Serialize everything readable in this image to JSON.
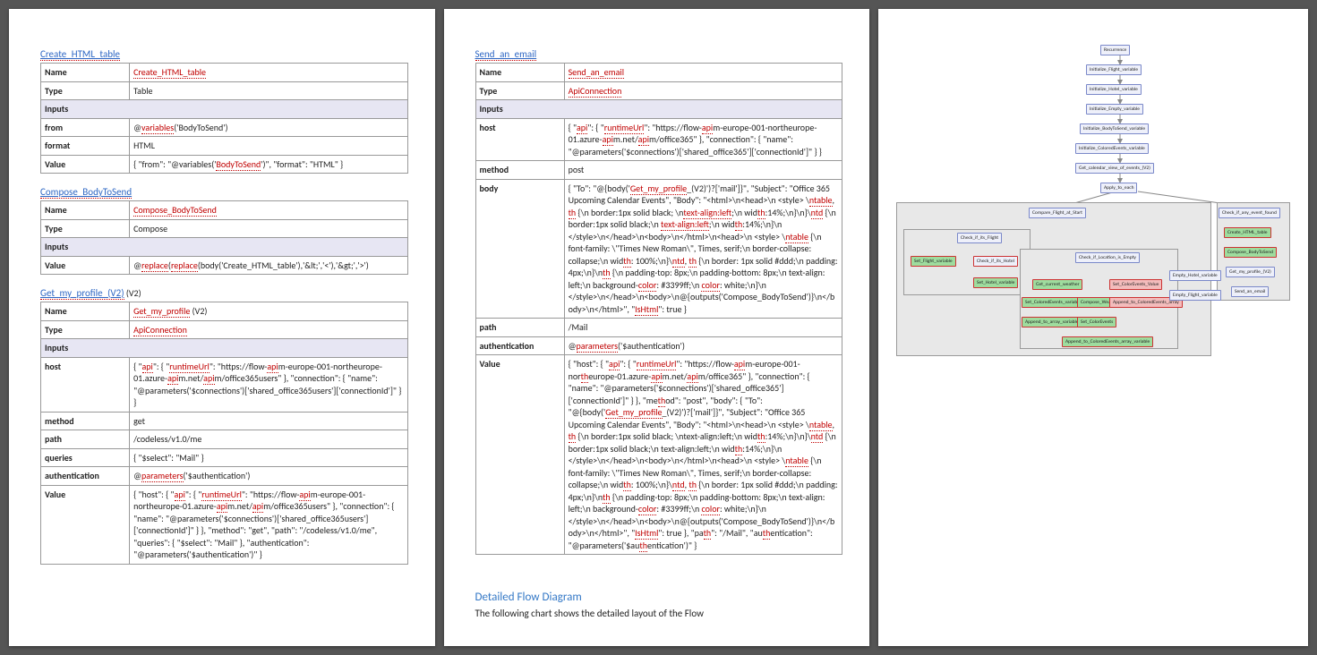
{
  "labels": {
    "name": "Name",
    "type": "Type",
    "inputs": "Inputs",
    "from": "from",
    "format": "format",
    "value": "Value",
    "host": "host",
    "method": "method",
    "path": "path",
    "queries": "queries",
    "auth": "authentication",
    "body": "body"
  },
  "tables": [
    {
      "anchor": "Create_HTML_table",
      "name": "Create_HTML_table",
      "name_sp": true,
      "type": "Table",
      "rows": [
        {
          "k": "from",
          "v": "@variables('BodyToSend')",
          "sp": [
            "variables"
          ]
        },
        {
          "k": "format",
          "v": "HTML"
        },
        {
          "k": "Value",
          "v": "{  \"from\": \"@variables('BodyToSend')\",  \"format\": \"HTML\" }",
          "sp": [
            "BodyToSend"
          ]
        }
      ]
    },
    {
      "anchor": "Compose_BodyToSend",
      "name": "Compose_BodyToSend",
      "name_sp": true,
      "type": "Compose",
      "rows": [
        {
          "k": "Value",
          "v": "@replace(replace(body('Create_HTML_table'),'&lt;','<'),'&gt;','>')",
          "sp": [
            "replace"
          ]
        }
      ]
    },
    {
      "anchor": "Get_my_profile_(V2)",
      "trail": " (V2)",
      "name": "Get_my_profile",
      "name_sp": true,
      "type": "ApiConnection",
      "type_sp": true,
      "rows": [
        {
          "k": "host",
          "v": "{  \"api\": {   \"runtimeUrl\": \"https://flow-apim-europe-001-northeurope-01.azure-apim.net/apim/office365users\"  },  \"connection\": {   \"name\": \"@parameters('$connections')['shared_office365users']['connectionId']\"  } }",
          "sp": [
            "api",
            "runtimeUrl"
          ]
        },
        {
          "k": "method",
          "v": "get"
        },
        {
          "k": "path",
          "v": "/codeless/v1.0/me"
        },
        {
          "k": "queries",
          "v": "{  \"$select\": \"Mail\" }"
        },
        {
          "k": "authentication",
          "v": "@parameters('$authentication')",
          "sp": [
            "parameters"
          ]
        },
        {
          "k": "Value",
          "v": "{  \"host\": {   \"api\": {    \"runtimeUrl\": \"https://flow-apim-europe-001-northeurope-01.azure-apim.net/apim/office365users\"   },   \"connection\": {    \"name\": \"@parameters('$connections')['shared_office365users']['connectionId']\"   }  },  \"method\": \"get\",  \"path\": \"/codeless/v1.0/me\",  \"queries\": {   \"$select\": \"Mail\"  },  \"authentication\": \"@parameters('$authentication')\" }",
          "sp": [
            "api",
            "runtimeUrl"
          ]
        }
      ]
    },
    {
      "anchor": "Send_an_email",
      "name": "Send_an_email",
      "name_sp": true,
      "type": "ApiConnection",
      "type_sp": true,
      "rows": [
        {
          "k": "host",
          "v": "{  \"api\": {   \"runtimeUrl\": \"https://flow-apim-europe-001-northeurope-01.azure-apim.net/apim/office365\"  },  \"connection\": {   \"name\": \"@parameters('$connections')['shared_office365']['connectionId']\"  } }",
          "sp": [
            "api",
            "runtimeUrl"
          ]
        },
        {
          "k": "method",
          "v": "post"
        },
        {
          "k": "body",
          "v": "{  \"To\": \"@{body('Get_my_profile_(V2)')?['mail']}\",  \"Subject\": \"Office 365 Upcoming Calendar Events\",  \"Body\": \"<html>\\n<head>\\n  <style> \\ntable, th {\\n    border:1px solid black;   \\ntext-align:left;\\n    width:14%;\\n}\\n}\\ntd {\\n    border:1px solid black;\\n    text-align:left;\\n    width:14%;\\n}\\n  </style>\\n</head>\\n<body>\\n</html>\\n<head>\\n  <style> \\ntable {\\n    font-family: \\\"Times New Roman\\\", Times, serif;\\n    border-collapse: collapse;\\n    width: 100%;\\n}\\ntd, th {\\n    border: 1px solid #ddd;\\n    padding: 4px;\\n}\\nth {\\n    padding-top: 8px;\\n    padding-bottom: 8px;\\n    text-align: left;\\n    background-color: #3399ff;\\n    color: white;\\n}\\n  </style>\\n</head>\\n<body>\\n@{outputs('Compose_BodyToSend')}\\n</body>\\n</html>\",  \"IsHtml\": true }",
          "sp": [
            "Get_my_profile",
            "ntable",
            "th",
            "ntd",
            "text-align:left",
            "color",
            "IsHtml"
          ]
        },
        {
          "k": "path",
          "v": "/Mail"
        },
        {
          "k": "authentication",
          "v": "@parameters('$authentication')",
          "sp": [
            "parameters"
          ]
        },
        {
          "k": "Value",
          "v": "{  \"host\": {   \"api\": {    \"runtimeUrl\": \"https://flow-apim-europe-001-northeurope-01.azure-apim.net/apim/office365\"   },   \"connection\": {    \"name\": \"@parameters('$connections')['shared_office365']['connectionId']\"   }  },  \"method\": \"post\",  \"body\": {   \"To\": \"@{body('Get_my_profile_(V2)')?['mail']}\",   \"Subject\": \"Office 365 Upcoming Calendar Events\",   \"Body\": \"<html>\\n<head>\\n  <style> \\ntable, th {\\n    border:1px solid black;   \\ntext-align:left;\\n    width:14%;\\n}\\n}\\ntd {\\n    border:1px solid black;\\n    text-align:left;\\n    width:14%;\\n}\\n  </style>\\n</head>\\n<body>\\n</html>\\n<head>\\n  <style> \\ntable {\\n    font-family: \\\"Times New Roman\\\", Times, serif;\\n    border-collapse: collapse;\\n    width: 100%;\\n}\\ntd, th {\\n    border: 1px solid #ddd;\\n    padding: 4px;\\n}\\nth {\\n    padding-top: 8px;\\n    padding-bottom: 8px;\\n    text-align: left;\\n    background-color: #3399ff;\\n    color: white;\\n}\\n  </style>\\n</head>\\n<body>\\n@{outputs('Compose_BodyToSend')}\\n</body>\\n</html>\",   \"IsHtml\": true  },  \"path\": \"/Mail\",  \"authentication\": \"@parameters('$authentication')\" }",
          "sp": [
            "api",
            "runtimeUrl",
            "Get_my_profile",
            "ntable",
            "th",
            "ntd",
            "color",
            "IsHtml"
          ]
        }
      ]
    }
  ],
  "section": {
    "title": "Detailed Flow Diagram",
    "sub": "The following chart shows the detailed layout of the Flow"
  },
  "flow": {
    "top": [
      "Recurrence",
      "Initialize_Flight_variable",
      "Initialize_Hotel_variable",
      "Initialize_Empty_variable",
      "Initialize_BodyToSend_variable",
      "Initialize_ColoredEvents_variable",
      "Get_calendar_view_of_events_(V2)"
    ],
    "apply": "Apply_to_each",
    "compare": "Compare_Flight_at_Start",
    "check_if": "Check_if_its_Flight",
    "set_flight": "Set_Flight_variable",
    "check_hotel": "Check_if_its_Hotel",
    "set_hotel": "Set_Hotel_variable",
    "check_loc": "Check_if_Location_is_Empty",
    "get_weather": "Get_current_weather",
    "set_colored": "Set_ColoredEvents_variable",
    "append_arr": "Append_to_array_variable",
    "compose_weather": "Compose_Weather",
    "set_colored2": "Set_ColorEvents_Value",
    "set_cevents": "Set_ColorEvents",
    "append_colored": "Append_to_ColoredEvents_array",
    "append_colored2": "Append_to_ColoredEvents_array_variable",
    "check_events": "Check_if_any_event_found",
    "create_html": "Create_HTML_table",
    "compose_body": "Compose_BodyToSend",
    "get_profile": "Get_my_profile_(V2)",
    "send_email": "Send_an_email",
    "empty_hotel": "Empty_Hotel_variable",
    "empty_flight": "Empty_Flight_variable"
  }
}
